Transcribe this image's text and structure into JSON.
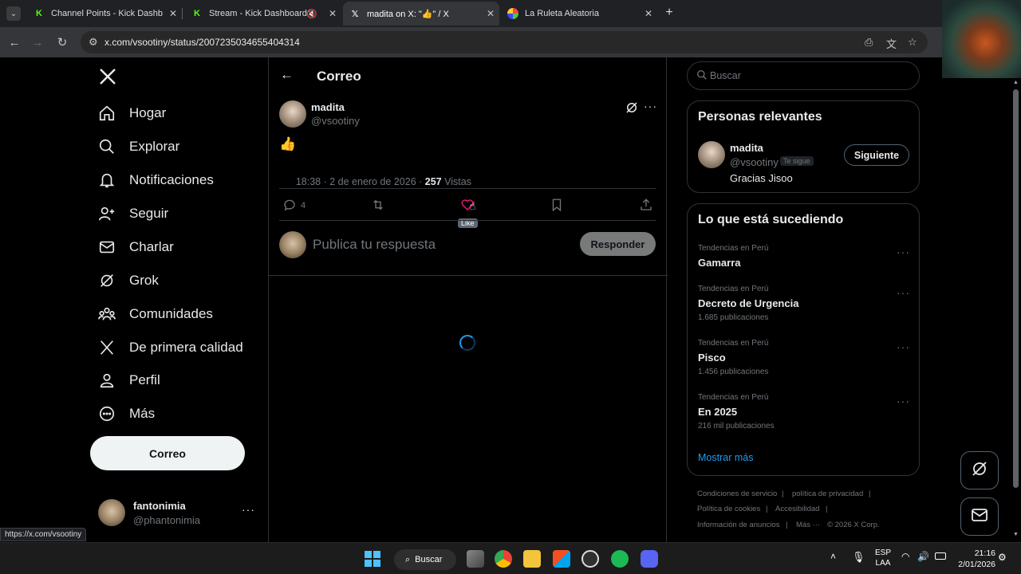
{
  "browser": {
    "tabs": [
      {
        "title": "Channel Points - Kick Dashboar",
        "icon": "kick-icon"
      },
      {
        "title": "Stream - Kick Dashboard",
        "icon": "kick-icon"
      },
      {
        "title": "madita on X: \"👍\" / X",
        "icon": "x-logo-icon"
      },
      {
        "title": "La Ruleta Aleatoria",
        "icon": "roulette-icon"
      }
    ],
    "url": "x.com/vsootiny/status/2007235034655404314",
    "status_url": "https://x.com/vsootiny"
  },
  "nav": {
    "items": [
      {
        "label": "Hogar"
      },
      {
        "label": "Explorar"
      },
      {
        "label": "Notificaciones"
      },
      {
        "label": "Seguir"
      },
      {
        "label": "Charlar"
      },
      {
        "label": "Grok"
      },
      {
        "label": "Comunidades"
      },
      {
        "label": "De primera calidad"
      },
      {
        "label": "Perfil"
      },
      {
        "label": "Más"
      }
    ],
    "post_button": "Correo",
    "account": {
      "name": "fantonimia",
      "handle": "@phantonimia"
    }
  },
  "main": {
    "header_title": "Correo",
    "post": {
      "author_name": "madita",
      "author_handle": "@vsootiny",
      "content": "👍",
      "timestamp": "18:38 · 2 de enero de 2026 · ",
      "views_count": "257",
      "views_label": "Vistas",
      "reply_count": "4",
      "like_tooltip": "Like"
    },
    "reply_placeholder": "Publica tu respuesta",
    "reply_button": "Responder"
  },
  "sidebar": {
    "search_placeholder": "Buscar",
    "relevant": {
      "title": "Personas relevantes",
      "name": "madita",
      "handle": "@vsootiny",
      "follows_you": "Te sigue",
      "bio": "Gracias Jisoo",
      "follow_button": "Siguiente"
    },
    "trending": {
      "title": "Lo que está sucediendo",
      "items": [
        {
          "category": "Tendencias en Perú",
          "name": "Gamarra",
          "count": ""
        },
        {
          "category": "Tendencias en Perú",
          "name": "Decreto de Urgencia",
          "count": "1.685 publicaciones"
        },
        {
          "category": "Tendencias en Perú",
          "name": "Pisco",
          "count": "1.456 publicaciones"
        },
        {
          "category": "Tendencias en Perú",
          "name": "En 2025",
          "count": "216 mil publicaciones"
        }
      ],
      "show_more": "Mostrar más"
    },
    "footer": {
      "terms": "Condiciones de servicio",
      "privacy": "política de privacidad",
      "cookies": "Política de cookies",
      "accessibility": "Accesibilidad",
      "ads": "Información de anuncios",
      "more": "Más ···",
      "copyright": "© 2026 X Corp."
    }
  },
  "taskbar": {
    "search_label": "Buscar",
    "lang_line1": "ESP",
    "lang_line2": "LAA",
    "time": "21:16",
    "date": "2/01/2026"
  },
  "colors": {
    "accent": "#1d9bf0",
    "like": "#f91880",
    "background": "#000000",
    "border": "#2f3336",
    "muted": "#71767b"
  }
}
